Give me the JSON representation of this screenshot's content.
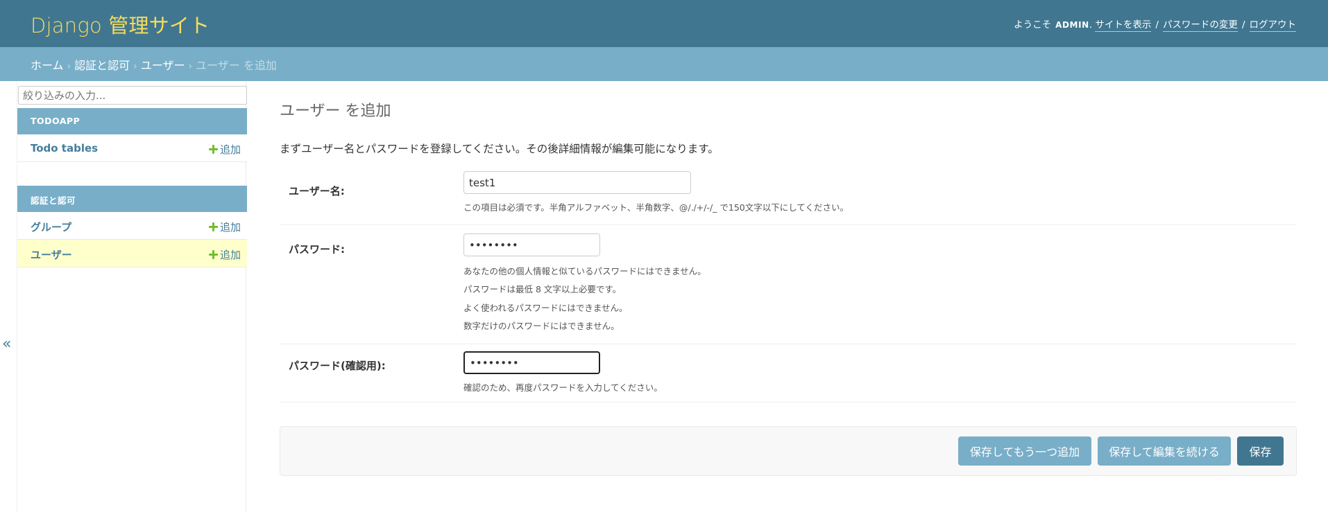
{
  "header": {
    "branding": "Django 管理サイト",
    "welcome": "ようこそ",
    "username": "ADMIN",
    "links": [
      "サイトを表示",
      "パスワードの変更",
      "ログアウト"
    ]
  },
  "breadcrumbs": {
    "items": [
      "ホーム",
      "認証と認可",
      "ユーザー"
    ],
    "current": "ユーザー を追加"
  },
  "sidebar": {
    "filter_placeholder": "絞り込みの入力...",
    "modules": [
      {
        "caption": "TODOAPP",
        "models": [
          {
            "name": "Todo tables",
            "add": "追加"
          }
        ]
      },
      {
        "caption": "認証と認可",
        "models": [
          {
            "name": "グループ",
            "add": "追加"
          },
          {
            "name": "ユーザー",
            "add": "追加"
          }
        ]
      }
    ],
    "toggle": "«"
  },
  "content": {
    "title": "ユーザー を追加",
    "intro": "まずユーザー名とパスワードを登録してください。その後詳細情報が編集可能になります。",
    "fields": {
      "username": {
        "label": "ユーザー名:",
        "value": "test1",
        "help": "この項目は必須です。半角アルファベット、半角数字、@/./+/-/_ で150文字以下にしてください。"
      },
      "password1": {
        "label": "パスワード:",
        "value": "••••••••",
        "help": [
          "あなたの他の個人情報と似ているパスワードにはできません。",
          "パスワードは最低 8 文字以上必要です。",
          "よく使われるパスワードにはできません。",
          "数字だけのパスワードにはできません。"
        ]
      },
      "password2": {
        "label": "パスワード(確認用):",
        "value": "••••••••",
        "help": "確認のため、再度パスワードを入力してください。"
      }
    },
    "buttons": {
      "save_add_another": "保存してもう一つ追加",
      "save_continue": "保存して編集を続ける",
      "save": "保存"
    }
  },
  "colors": {
    "header_bg": "#417690",
    "branding": "#f5dd5d",
    "breadcrumbs_bg": "#79aec8",
    "module_caption_bg": "#79aec8",
    "current_row_bg": "#ffffcc",
    "add_icon": "#70bf2b",
    "primary_button": "#417690",
    "secondary_button": "#79aec8"
  },
  "icons": [
    "plus-icon",
    "double-chevron-left-icon"
  ]
}
